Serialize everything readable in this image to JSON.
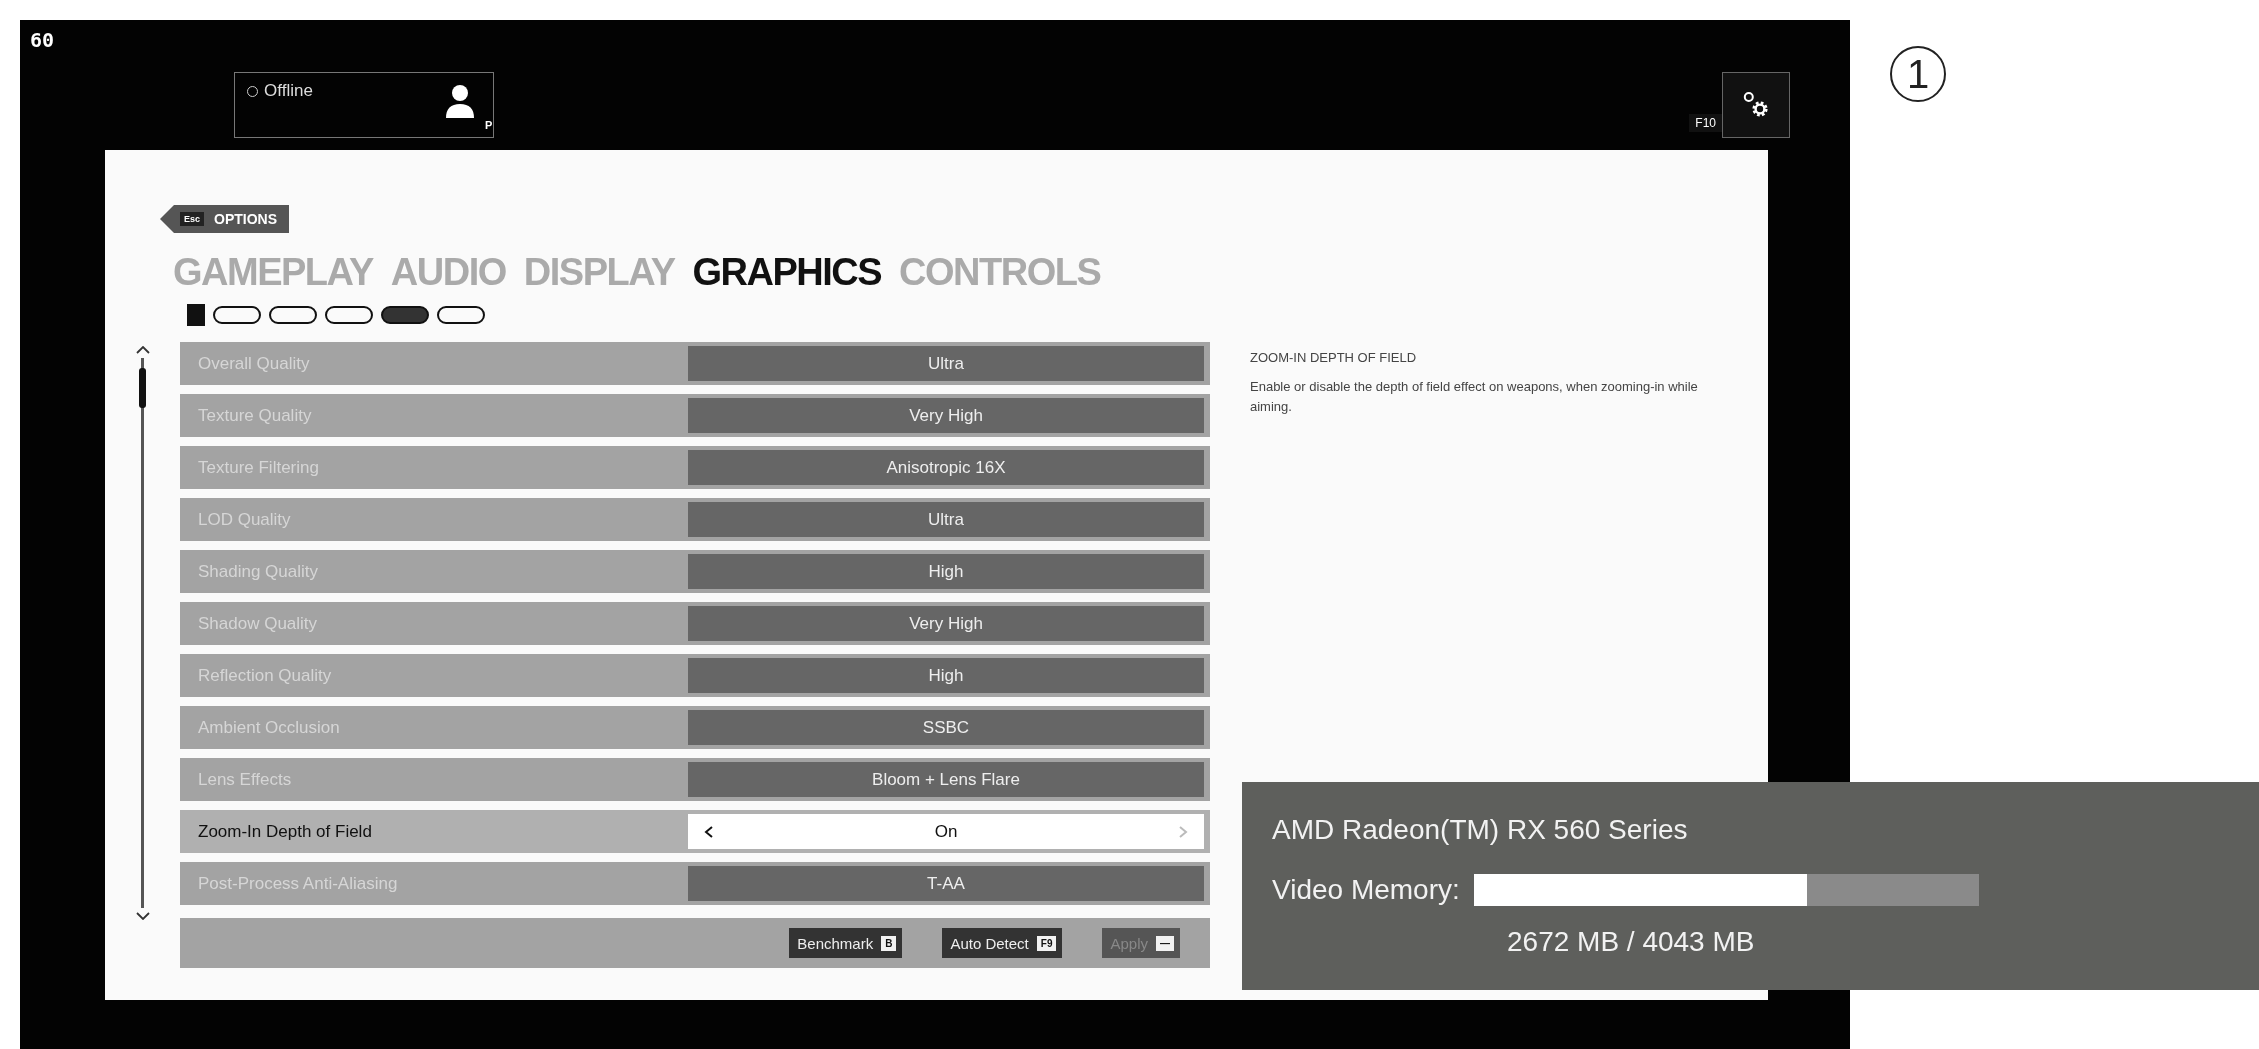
{
  "fps": "60",
  "profile": {
    "status": "Offline",
    "online": false,
    "key": "P"
  },
  "settings_button": {
    "key": "F10"
  },
  "annotation": "1",
  "back": {
    "key": "Esc",
    "label": "OPTIONS"
  },
  "tabs": [
    {
      "label": "GAMEPLAY",
      "selected": false
    },
    {
      "label": "AUDIO",
      "selected": false
    },
    {
      "label": "DISPLAY",
      "selected": false
    },
    {
      "label": "GRAPHICS",
      "selected": true
    },
    {
      "label": "CONTROLS",
      "selected": false
    }
  ],
  "pages": [
    {
      "selected": false
    },
    {
      "selected": false
    },
    {
      "selected": false
    },
    {
      "selected": true
    },
    {
      "selected": false
    }
  ],
  "settings": [
    {
      "label": "Overall Quality",
      "value": "Ultra",
      "selected": false
    },
    {
      "label": "Texture Quality",
      "value": "Very High",
      "selected": false
    },
    {
      "label": "Texture Filtering",
      "value": "Anisotropic 16X",
      "selected": false
    },
    {
      "label": "LOD Quality",
      "value": "Ultra",
      "selected": false
    },
    {
      "label": "Shading Quality",
      "value": "High",
      "selected": false
    },
    {
      "label": "Shadow Quality",
      "value": "Very High",
      "selected": false
    },
    {
      "label": "Reflection Quality",
      "value": "High",
      "selected": false
    },
    {
      "label": "Ambient Occlusion",
      "value": "SSBC",
      "selected": false
    },
    {
      "label": "Lens Effects",
      "value": "Bloom + Lens Flare",
      "selected": false
    },
    {
      "label": "Zoom-In Depth of Field",
      "value": "On",
      "selected": true
    },
    {
      "label": "Post-Process Anti-Aliasing",
      "value": "T-AA",
      "selected": false
    }
  ],
  "buttons": [
    {
      "label": "Benchmark",
      "key": "B",
      "disabled": false
    },
    {
      "label": "Auto Detect",
      "key": "F9",
      "disabled": false
    },
    {
      "label": "Apply",
      "key": "—",
      "disabled": true
    }
  ],
  "description": {
    "title": "ZOOM-IN DEPTH OF FIELD",
    "text": "Enable or disable the depth of field effect on weapons, when zooming-in while aiming."
  },
  "gpu": {
    "name": "AMD Radeon(TM) RX 560 Series",
    "memory_label": "Video Memory:",
    "level": 0.66,
    "reading": "2672 MB / 4043 MB"
  }
}
